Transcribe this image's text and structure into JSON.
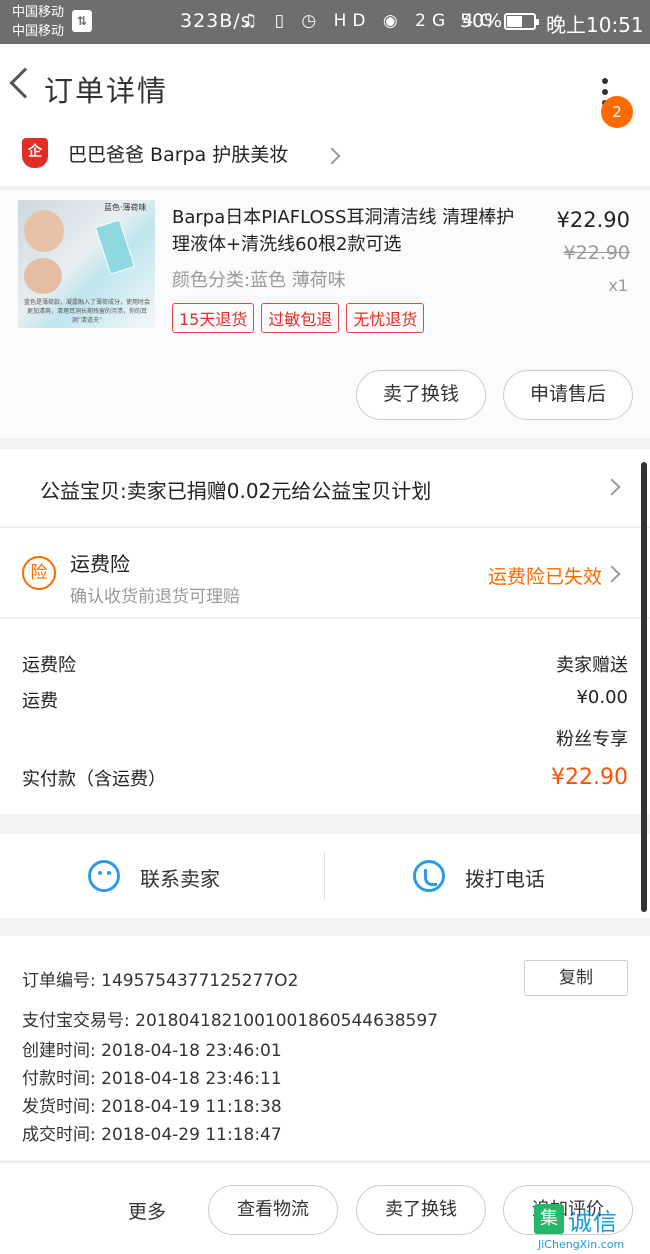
{
  "status_bar": {
    "carrier_1": "中国移动",
    "carrier_2": "中国移动",
    "speed": "323B/s",
    "icons": "♫ ▯ ◷ HD ◉ 2G 4G",
    "battery": "50%",
    "time": "晚上10:51"
  },
  "nav": {
    "title": "订单详情",
    "badge_count": "2"
  },
  "shop": {
    "icon_char": "企",
    "name": "巴巴爸爸 Barpa 护肤美妆"
  },
  "product": {
    "image_tag": "蓝色·薄荷味",
    "image_caption": "蓝色是薄荷款，凝露融入了薄荷成分，使用时会更加清爽，清理耳洞长期残留的污渍，你的耳洞“清道夫”",
    "title": "Barpa日本PIAFLOSS耳洞清洁线 清理棒护理液体+清洗线60根2款可选",
    "sku": "颜色分类:蓝色 薄荷味",
    "price": "¥22.90",
    "original_price": "¥22.90",
    "quantity": "x1",
    "tags": [
      "15天退货",
      "过敏包退",
      "无忧退货"
    ],
    "resell_button": "卖了换钱",
    "aftersale_button": "申请售后"
  },
  "charity": {
    "text": "公益宝贝:卖家已捐赠0.02元给公益宝贝计划"
  },
  "insurance": {
    "icon_char": "险",
    "title": "运费险",
    "description": "确认收货前退货可理赔",
    "status": "运费险已失效"
  },
  "summary": {
    "insurance_label": "运费险",
    "insurance_value": "卖家赠送",
    "shipping_label": "运费",
    "shipping_value": "¥0.00",
    "fans_note": "粉丝专享",
    "total_label": "实付款（含运费）",
    "total_value": "¥22.90"
  },
  "contact": {
    "seller_label": "联系卖家",
    "phone_label": "拨打电话"
  },
  "order_info": {
    "order_no": "订单编号:  1495754377125277O2",
    "alipay_no": "支付宝交易号:  2018041821001001860544638597",
    "created": "创建时间:  2018-04-18 23:46:01",
    "paid": "付款时间:  2018-04-18 23:46:11",
    "shipped": "发货时间:  2018-04-19 11:18:38",
    "completed": "成交时间:  2018-04-29 11:18:47",
    "copy_button": "复制"
  },
  "bottom_bar": {
    "more": "更多",
    "logistics_button": "查看物流",
    "resell_button": "卖了换钱",
    "review_button": "追加评价"
  },
  "watermark": {
    "logo_char": "集",
    "text": "诚信",
    "url": "JiChengXin.com"
  },
  "colors": {
    "accent_orange": "#ff6a00",
    "tag_red": "#e02e24",
    "contact_blue": "#2f9be8"
  }
}
